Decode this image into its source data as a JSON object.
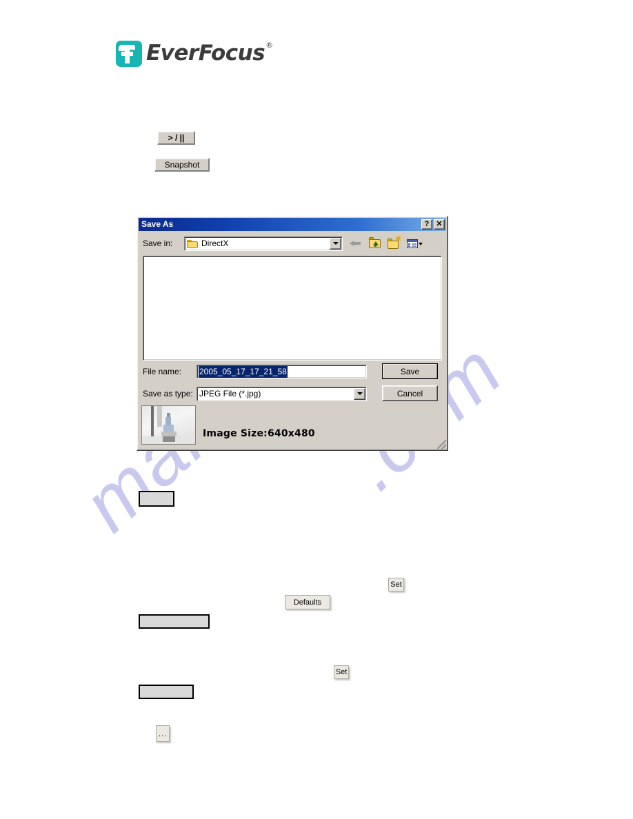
{
  "brand": {
    "name": "EverFocus",
    "registered_mark": "®",
    "logo_color": "#18b5b5",
    "wordmark_color": "#3b3b3b"
  },
  "watermark": {
    "line1": "manualslive",
    "line2": ".com",
    "color": "#c9c9ef"
  },
  "toolbar_buttons": {
    "play_pause_label": "> / ||",
    "snapshot_label": "Snapshot"
  },
  "dialog": {
    "title": "Save As",
    "help_button_label": "?",
    "close_button_label": "✕",
    "save_in": {
      "label": "Save in:",
      "value": "DirectX",
      "icon": "folder-icon"
    },
    "nav_icons": [
      {
        "name": "back-icon",
        "tooltip": "Back"
      },
      {
        "name": "up-one-level-icon",
        "tooltip": "Up One Level"
      },
      {
        "name": "new-folder-icon",
        "tooltip": "Create New Folder"
      },
      {
        "name": "views-icon",
        "tooltip": "Views"
      }
    ],
    "file_list_items": [],
    "file_name": {
      "label": "File name:",
      "value": "2005_05_17_17_21_58",
      "selected": true,
      "selection_color": "#08246b"
    },
    "save_as_type": {
      "label": "Save as type:",
      "value": "JPEG File (*.jpg)",
      "options": [
        "JPEG File (*.jpg)"
      ]
    },
    "save_button_label": "Save",
    "cancel_button_label": "Cancel",
    "preview": {
      "image_size_text": "Image Size:640x480",
      "thumbnail_name": "snapshot-thumbnail"
    }
  },
  "page_buttons": {
    "blank_small_1": "",
    "set_1": "Set",
    "defaults": "Defaults",
    "blank_wide_1": "",
    "set_2": "Set",
    "blank_wide_2": "",
    "ellipsis_browse": "..."
  }
}
